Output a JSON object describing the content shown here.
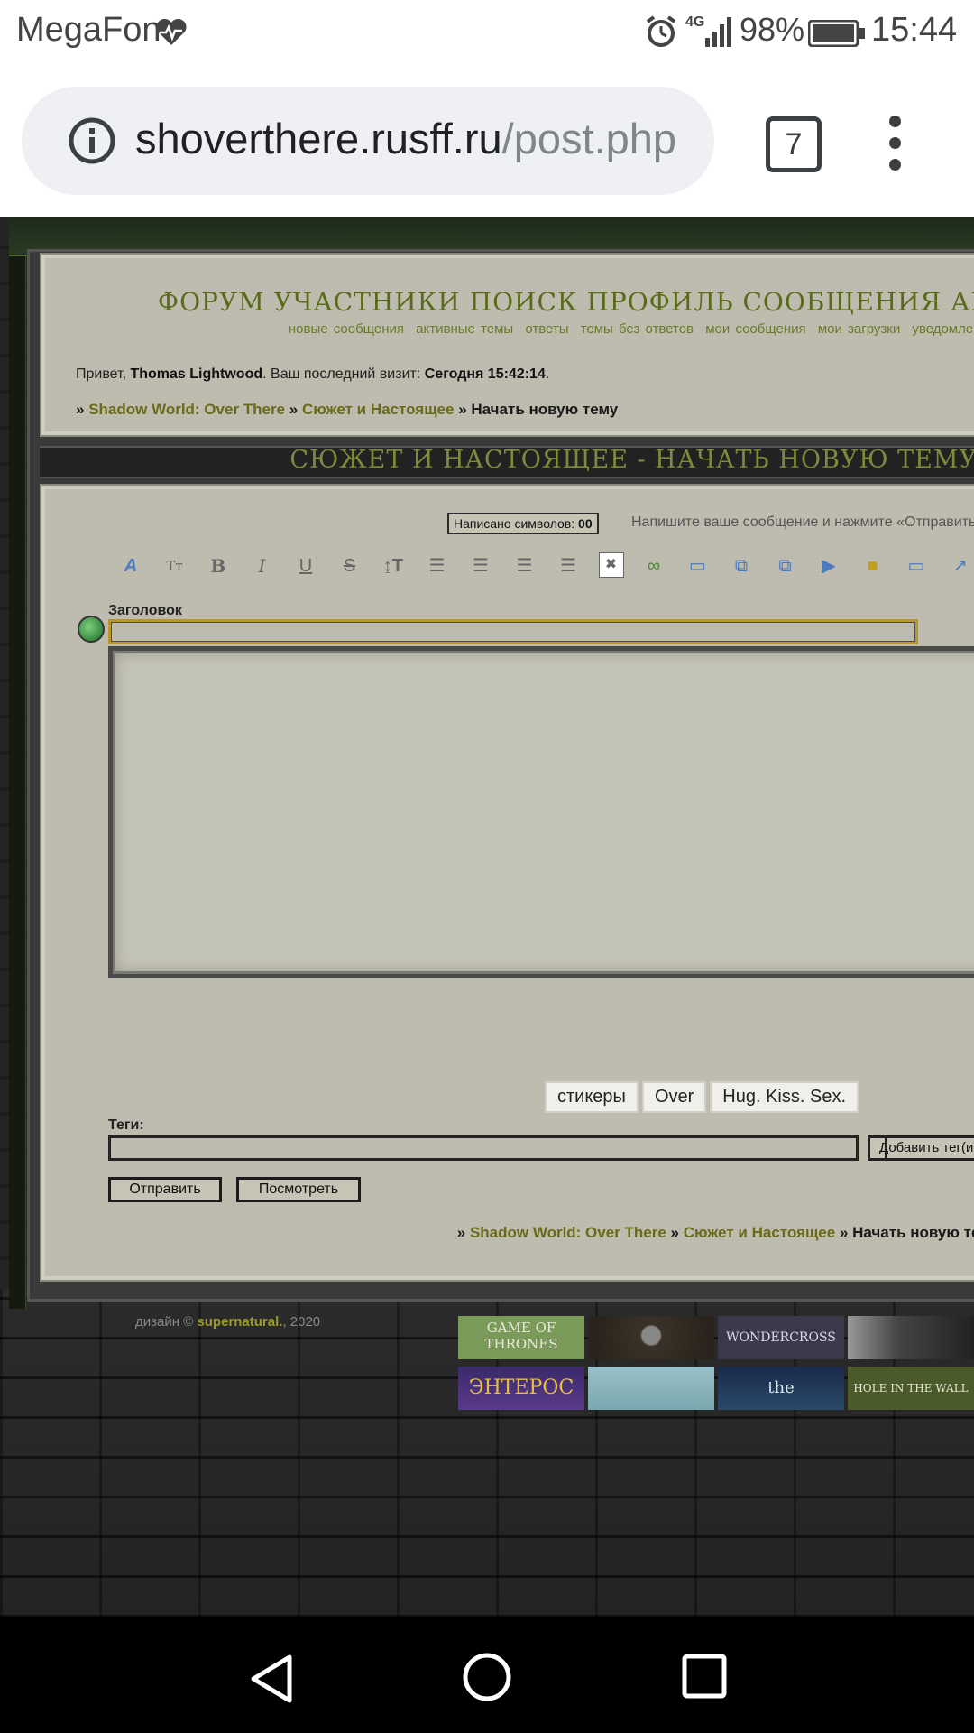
{
  "statusbar": {
    "carrier": "MegaFon",
    "network": "4G",
    "battery": "98%",
    "time": "15:44"
  },
  "browser": {
    "url_host": "shoverthere.rusff.ru",
    "url_path": "/post.php",
    "tab_count": "7"
  },
  "forum": {
    "top_nav": "ФОРУМ  УЧАСТНИКИ  ПОИСК  ПРОФИЛЬ  СООБЩЕНИЯ  АМ",
    "sub_nav": [
      "новые сообщения",
      "активные темы",
      "ответы",
      "темы без ответов",
      "мои сообщения",
      "мои загрузки",
      "уведомления"
    ],
    "greeting_prefix": "Привет, ",
    "username": "Thomas Lightwood",
    "last_visit_label": ".   Ваш последний визит: ",
    "last_visit_value": "Сегодня 15:42:14",
    "breadcrumb": {
      "sep": "» ",
      "forum": "Shadow World: Over There",
      "section": "Сюжет и Настоящее",
      "current": "Начать новую тему"
    },
    "page_title": "СЮЖЕТ И НАСТОЯЩЕЕ - НАЧАТЬ НОВУЮ ТЕМУ",
    "char_count_label": "Написано символов: ",
    "char_count": "00",
    "hint": "Напишите ваше сообщение и нажмите «Отправить»",
    "title_label": "Заголовок",
    "buttons": [
      "стикеры",
      "Over",
      "Hug. Kiss. Sex."
    ],
    "tags_label": "Теги:",
    "add_tag": "Добавить тег(и)",
    "send": "Отправить",
    "preview": "Посмотреть",
    "credit_prefix": "дизайн © ",
    "credit_name": "supernatural.",
    "credit_year": ", 2020",
    "banners": [
      "GAME OF THRONES",
      "",
      "WONDERCROSS",
      "",
      "ЭНТЕРОС",
      "",
      "the ORIGINALS",
      "HOLE IN THE WALL"
    ]
  },
  "toolbar_icons": [
    "font-color-icon",
    "font-size-icon",
    "bold-icon",
    "italic-icon",
    "underline-icon",
    "strike-icon",
    "text-height-icon",
    "align-left-icon",
    "align-center-icon",
    "align-justify-icon",
    "align-right-icon",
    "image-icon",
    "link-icon",
    "book-icon",
    "copy-icon",
    "copy2-icon",
    "video-icon",
    "lock-icon",
    "speech-bubble-icon",
    "upload-icon"
  ]
}
